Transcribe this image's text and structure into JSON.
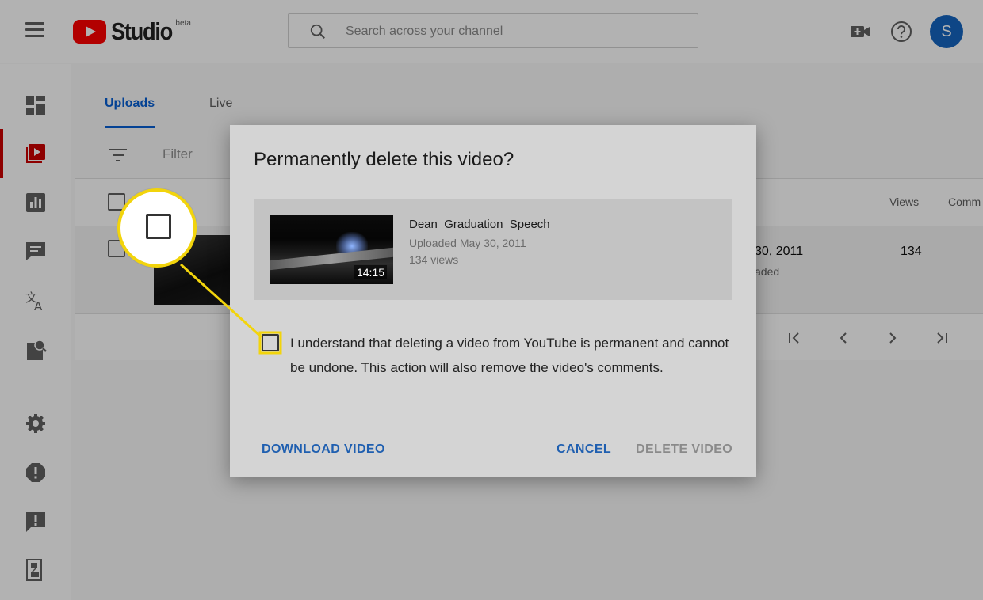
{
  "app": {
    "logo_text": "Studio",
    "logo_badge": "beta"
  },
  "search": {
    "placeholder": "Search across your channel"
  },
  "user": {
    "avatar_initial": "S"
  },
  "tabs": [
    {
      "label": "Uploads",
      "active": true
    },
    {
      "label": "Live",
      "active": false
    }
  ],
  "filter": {
    "label": "Filter"
  },
  "table": {
    "columns": [
      "Views",
      "Comm"
    ],
    "row": {
      "date": "30, 2011",
      "status": "aded",
      "views": "134"
    }
  },
  "dialog": {
    "title": "Permanently delete this video?",
    "video": {
      "title": "Dean_Graduation_Speech",
      "uploaded": "Uploaded May 30, 2011",
      "views": "134 views",
      "duration": "14:15"
    },
    "acknowledge_text": "I understand that deleting a video from YouTube is permanent and cannot be undone. This action will also remove the video's comments.",
    "buttons": {
      "download": "DOWNLOAD VIDEO",
      "cancel": "CANCEL",
      "delete": "DELETE VIDEO"
    }
  },
  "colors": {
    "accent": "#065fd4",
    "brand": "#ff0000",
    "callout": "#f2d40c",
    "active_nav": "#cc0000"
  }
}
